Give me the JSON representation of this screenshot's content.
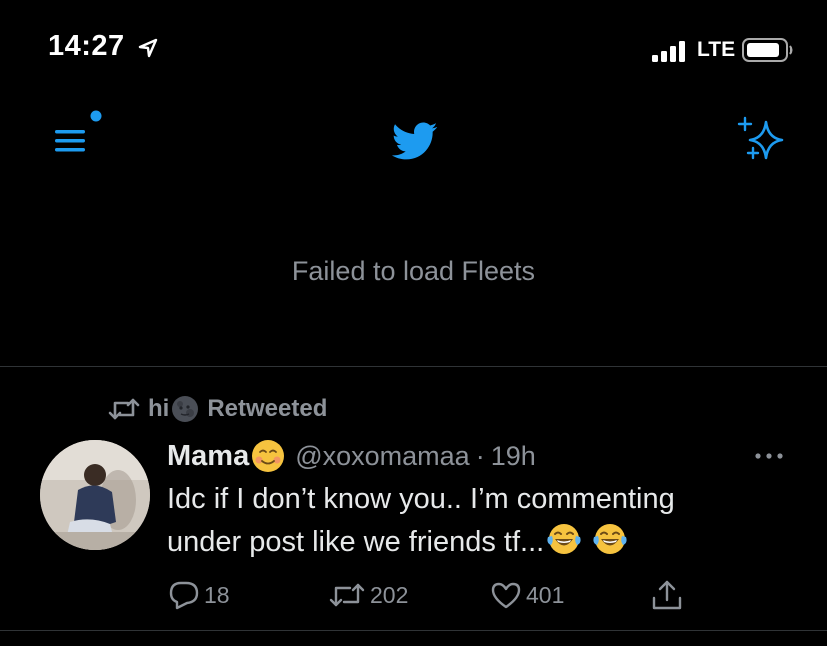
{
  "status_bar": {
    "time": "14:27",
    "network": "LTE"
  },
  "header": {
    "menu_icon": "menu-icon",
    "logo_icon": "twitter-bird-icon",
    "sparkle_icon": "sparkle-icon"
  },
  "fleets": {
    "message": "Failed to load Fleets"
  },
  "tweet": {
    "retweeted_by": "hi",
    "retweeted_label": "Retweeted",
    "display_name": "Mama",
    "handle": "@xoxomamaa",
    "separator": "·",
    "time_ago": "19h",
    "text_line_1": "Idc if I don’t know you.. I’m commenting",
    "text_line_2": "under post like we friends tf...",
    "replies": "18",
    "retweets": "202",
    "likes": "401"
  },
  "colors": {
    "accent": "#1d9bf0",
    "muted": "#8d9299",
    "text": "#e7e9ea",
    "background": "#000000",
    "divider": "#2f3336"
  }
}
